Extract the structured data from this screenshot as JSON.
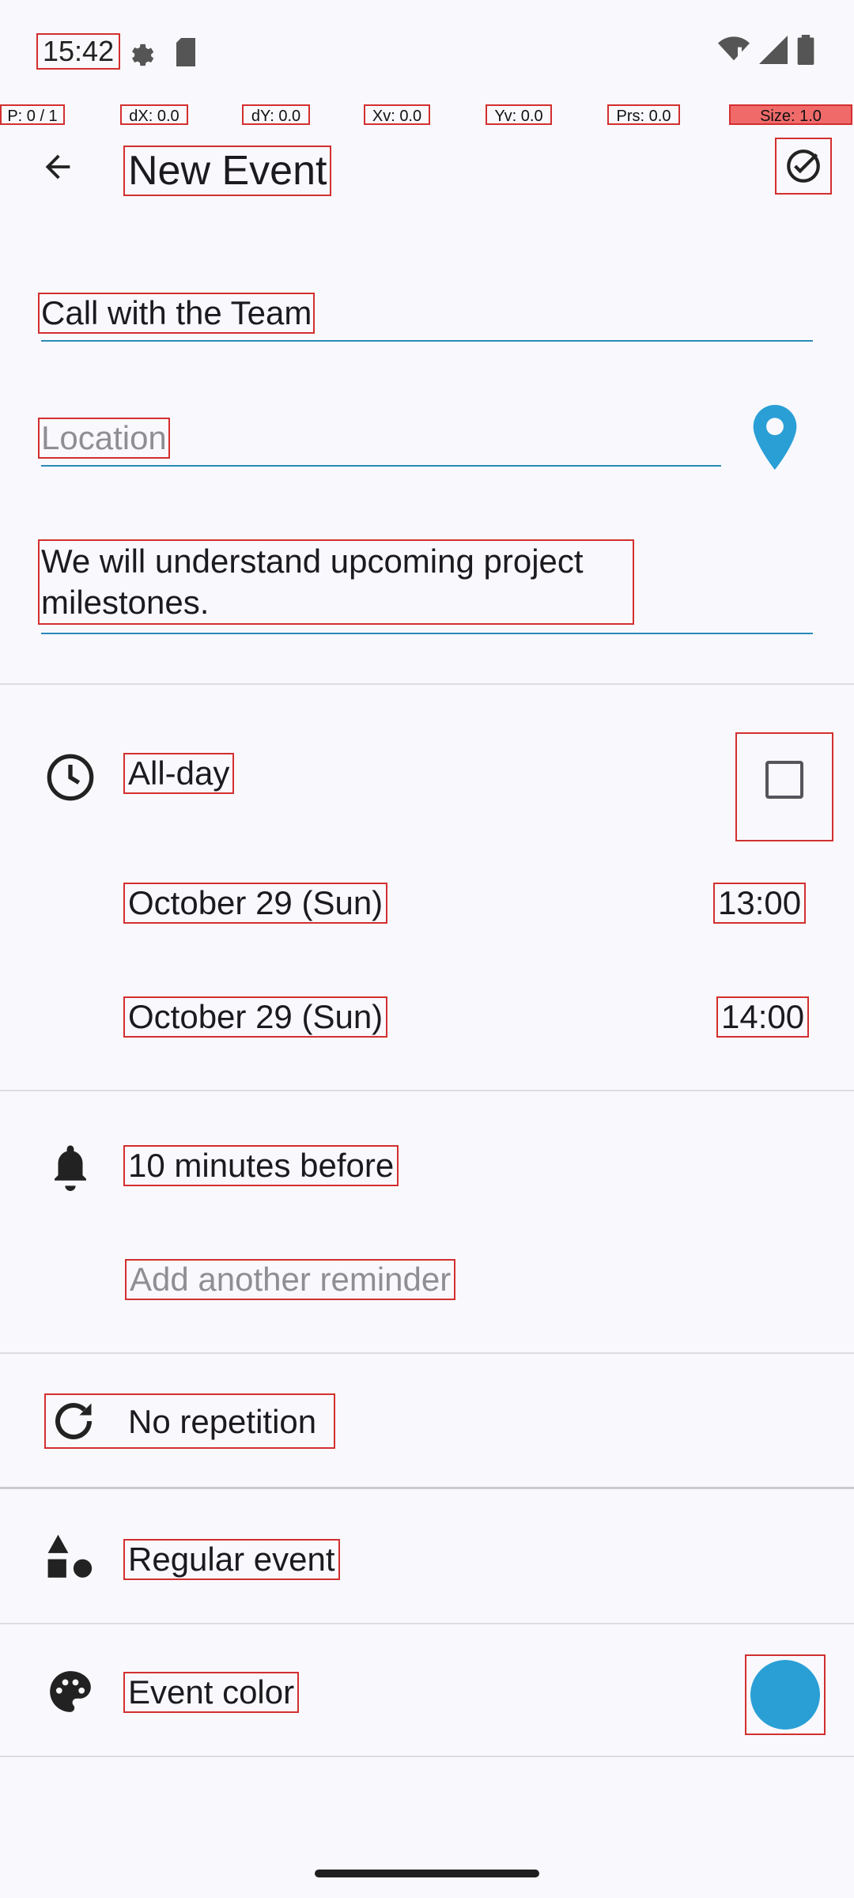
{
  "status_bar": {
    "time": "15:42"
  },
  "debug_overlay": {
    "pointer": "P: 0 / 1",
    "dx": "dX: 0.0",
    "dy": "dY: 0.0",
    "xv": "Xv: 0.0",
    "yv": "Yv: 0.0",
    "prs": "Prs: 0.0",
    "size": "Size: 1.0"
  },
  "app_bar": {
    "title": "New Event",
    "back_icon": "arrow-back-icon",
    "save_icon": "check-circle-icon"
  },
  "form": {
    "title_value": "Call with the Team",
    "location_placeholder": "Location",
    "description_value": "We will understand upcoming project milestones."
  },
  "time_section": {
    "all_day_label": "All-day",
    "all_day_checked": false,
    "start_date": "October 29 (Sun)",
    "start_time": "13:00",
    "end_date": "October 29 (Sun)",
    "end_time": "14:00"
  },
  "reminders": {
    "first": "10 minutes before",
    "add_placeholder": "Add another reminder"
  },
  "repetition": {
    "label": "No repetition"
  },
  "event_type": {
    "label": "Regular event"
  },
  "event_color": {
    "label": "Event color",
    "color": "#2a9fd6"
  },
  "colors": {
    "accent": "#2a8ab8",
    "highlight_box": "#d32f2f"
  }
}
